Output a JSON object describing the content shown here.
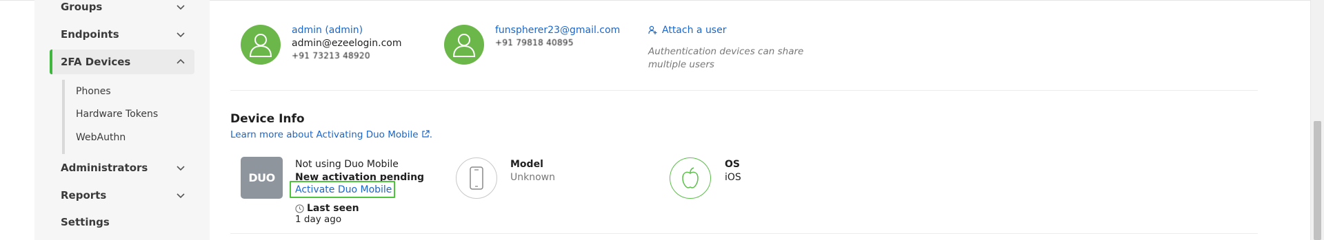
{
  "sidebar": {
    "items": [
      {
        "label": "Groups",
        "expanded": false
      },
      {
        "label": "Endpoints",
        "expanded": false
      },
      {
        "label": "2FA Devices",
        "expanded": true
      },
      {
        "label": "Administrators",
        "expanded": false
      },
      {
        "label": "Reports",
        "expanded": false
      },
      {
        "label": "Settings"
      }
    ],
    "subitems": [
      "Phones",
      "Hardware Tokens",
      "WebAuthn"
    ]
  },
  "users": [
    {
      "name": "admin (admin)",
      "email": "admin@ezeelogin.com",
      "phone": "+91 73213 48920"
    },
    {
      "name": "funspherer23@gmail.com",
      "phone": "+91 79818 40895"
    }
  ],
  "attach": {
    "label": "Attach a user",
    "note_line1": "Authentication devices can share",
    "note_line2": "multiple users"
  },
  "device_info": {
    "title": "Device Info",
    "learn_more": "Learn more about Activating Duo Mobile",
    "learn_more_suffix": ".",
    "duo_logo_text": "DUO",
    "status": "Not using Duo Mobile",
    "pending": "New activation pending",
    "activate_link": "Activate Duo Mobile",
    "last_seen_label": "Last seen",
    "last_seen_value": "1 day ago",
    "model_label": "Model",
    "model_value": "Unknown",
    "os_label": "OS",
    "os_value": "iOS"
  },
  "colors": {
    "accent_green": "#3fb73f",
    "avatar_green": "#6cb74a",
    "link_blue": "#1a66c9",
    "highlight_green": "#4cc43c"
  }
}
